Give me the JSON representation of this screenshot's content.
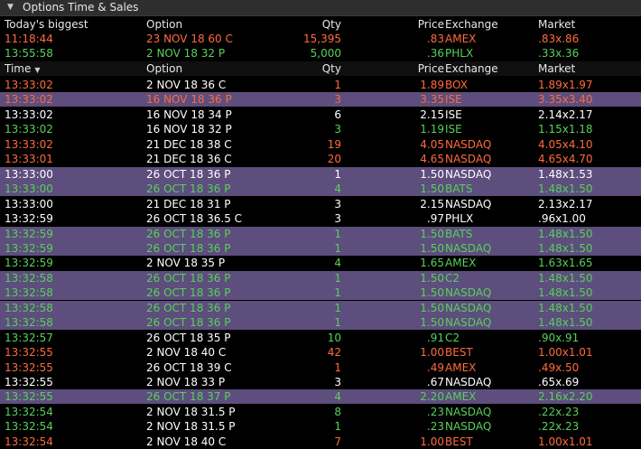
{
  "window": {
    "title": "Options Time & Sales"
  },
  "columns": {
    "biggest_label": "Today's biggest",
    "time": "Time",
    "option": "Option",
    "qty": "Qty",
    "price": "Price",
    "exchange": "Exchange",
    "market": "Market",
    "sort_icon": "▼"
  },
  "colors": {
    "down": "#ff6a3d",
    "up": "#58d05a",
    "neutral": "#ffffff",
    "highlight": "#5d4e7d"
  },
  "biggest": [
    {
      "time": "11:18:44",
      "option": "23 NOV 18 60 C",
      "qty": "15,395",
      "price": ".83",
      "exchange": "AMEX",
      "market": ".83x.86",
      "color": "r"
    },
    {
      "time": "13:55:58",
      "option": "2 NOV 18 32 P",
      "qty": "5,000",
      "price": ".36",
      "exchange": "PHLX",
      "market": ".33x.36",
      "color": "g"
    }
  ],
  "trades": [
    {
      "time": "13:33:02",
      "option": "2 NOV 18 36 C",
      "qty": "1",
      "price": "1.89",
      "exchange": "BOX",
      "market": "1.89x1.97",
      "color": "r",
      "hl": false
    },
    {
      "time": "13:33:02",
      "option": "16 NOV 18 36 P",
      "qty": "3",
      "price": "3.35",
      "exchange": "ISE",
      "market": "3.35x3.40",
      "color": "r",
      "hl": true
    },
    {
      "time": "13:33:02",
      "option": "16 NOV 18 34 P",
      "qty": "6",
      "price": "2.15",
      "exchange": "ISE",
      "market": "2.14x2.17",
      "color": "w",
      "hl": false
    },
    {
      "time": "13:33:02",
      "option": "16 NOV 18 32 P",
      "qty": "3",
      "price": "1.19",
      "exchange": "ISE",
      "market": "1.15x1.18",
      "color": "g",
      "hl": false
    },
    {
      "time": "13:33:02",
      "option": "21 DEC 18 38 C",
      "qty": "19",
      "price": "4.05",
      "exchange": "NASDAQ",
      "market": "4.05x4.10",
      "color": "r",
      "hl": false
    },
    {
      "time": "13:33:01",
      "option": "21 DEC 18 36 C",
      "qty": "20",
      "price": "4.65",
      "exchange": "NASDAQ",
      "market": "4.65x4.70",
      "color": "r",
      "hl": false
    },
    {
      "time": "13:33:00",
      "option": "26 OCT 18 36 P",
      "qty": "1",
      "price": "1.50",
      "exchange": "NASDAQ",
      "market": "1.48x1.53",
      "color": "w",
      "hl": true
    },
    {
      "time": "13:33:00",
      "option": "26 OCT 18 36 P",
      "qty": "4",
      "price": "1.50",
      "exchange": "BATS",
      "market": "1.48x1.50",
      "color": "g",
      "hl": true
    },
    {
      "time": "13:33:00",
      "option": "21 DEC 18 31 P",
      "qty": "3",
      "price": "2.15",
      "exchange": "NASDAQ",
      "market": "2.13x2.17",
      "color": "w",
      "hl": false
    },
    {
      "time": "13:32:59",
      "option": "26 OCT 18 36.5 C",
      "qty": "3",
      "price": ".97",
      "exchange": "PHLX",
      "market": ".96x1.00",
      "color": "w",
      "hl": false
    },
    {
      "time": "13:32:59",
      "option": "26 OCT 18 36 P",
      "qty": "1",
      "price": "1.50",
      "exchange": "BATS",
      "market": "1.48x1.50",
      "color": "g",
      "hl": true
    },
    {
      "time": "13:32:59",
      "option": "26 OCT 18 36 P",
      "qty": "1",
      "price": "1.50",
      "exchange": "NASDAQ",
      "market": "1.48x1.50",
      "color": "g",
      "hl": true
    },
    {
      "time": "13:32:59",
      "option": "2 NOV 18 35 P",
      "qty": "4",
      "price": "1.65",
      "exchange": "AMEX",
      "market": "1.63x1.65",
      "color": "g",
      "hl": false
    },
    {
      "time": "13:32:58",
      "option": "26 OCT 18 36 P",
      "qty": "1",
      "price": "1.50",
      "exchange": "C2",
      "market": "1.48x1.50",
      "color": "g",
      "hl": true
    },
    {
      "time": "13:32:58",
      "option": "26 OCT 18 36 P",
      "qty": "1",
      "price": "1.50",
      "exchange": "NASDAQ",
      "market": "1.48x1.50",
      "color": "g",
      "hl": true
    },
    {
      "time": "13:32:58",
      "option": "26 OCT 18 36 P",
      "qty": "1",
      "price": "1.50",
      "exchange": "NASDAQ",
      "market": "1.48x1.50",
      "color": "g",
      "hl": true
    },
    {
      "time": "13:32:58",
      "option": "26 OCT 18 36 P",
      "qty": "1",
      "price": "1.50",
      "exchange": "NASDAQ",
      "market": "1.48x1.50",
      "color": "g",
      "hl": true
    },
    {
      "time": "13:32:57",
      "option": "26 OCT 18 35 P",
      "qty": "10",
      "price": ".91",
      "exchange": "C2",
      "market": ".90x.91",
      "color": "g",
      "hl": false
    },
    {
      "time": "13:32:55",
      "option": "2 NOV 18 40 C",
      "qty": "42",
      "price": "1.00",
      "exchange": "BEST",
      "market": "1.00x1.01",
      "color": "r",
      "hl": false
    },
    {
      "time": "13:32:55",
      "option": "26 OCT 18 39 C",
      "qty": "1",
      "price": ".49",
      "exchange": "AMEX",
      "market": ".49x.50",
      "color": "r",
      "hl": false
    },
    {
      "time": "13:32:55",
      "option": "2 NOV 18 33 P",
      "qty": "3",
      "price": ".67",
      "exchange": "NASDAQ",
      "market": ".65x.69",
      "color": "w",
      "hl": false
    },
    {
      "time": "13:32:55",
      "option": "26 OCT 18 37 P",
      "qty": "4",
      "price": "2.20",
      "exchange": "AMEX",
      "market": "2.16x2.20",
      "color": "g",
      "hl": true
    },
    {
      "time": "13:32:54",
      "option": "2 NOV 18 31.5 P",
      "qty": "8",
      "price": ".23",
      "exchange": "NASDAQ",
      "market": ".22x.23",
      "color": "g",
      "hl": false
    },
    {
      "time": "13:32:54",
      "option": "2 NOV 18 31.5 P",
      "qty": "1",
      "price": ".23",
      "exchange": "NASDAQ",
      "market": ".22x.23",
      "color": "g",
      "hl": false
    },
    {
      "time": "13:32:54",
      "option": "2 NOV 18 40 C",
      "qty": "7",
      "price": "1.00",
      "exchange": "BEST",
      "market": "1.00x1.01",
      "color": "r",
      "hl": false
    }
  ]
}
